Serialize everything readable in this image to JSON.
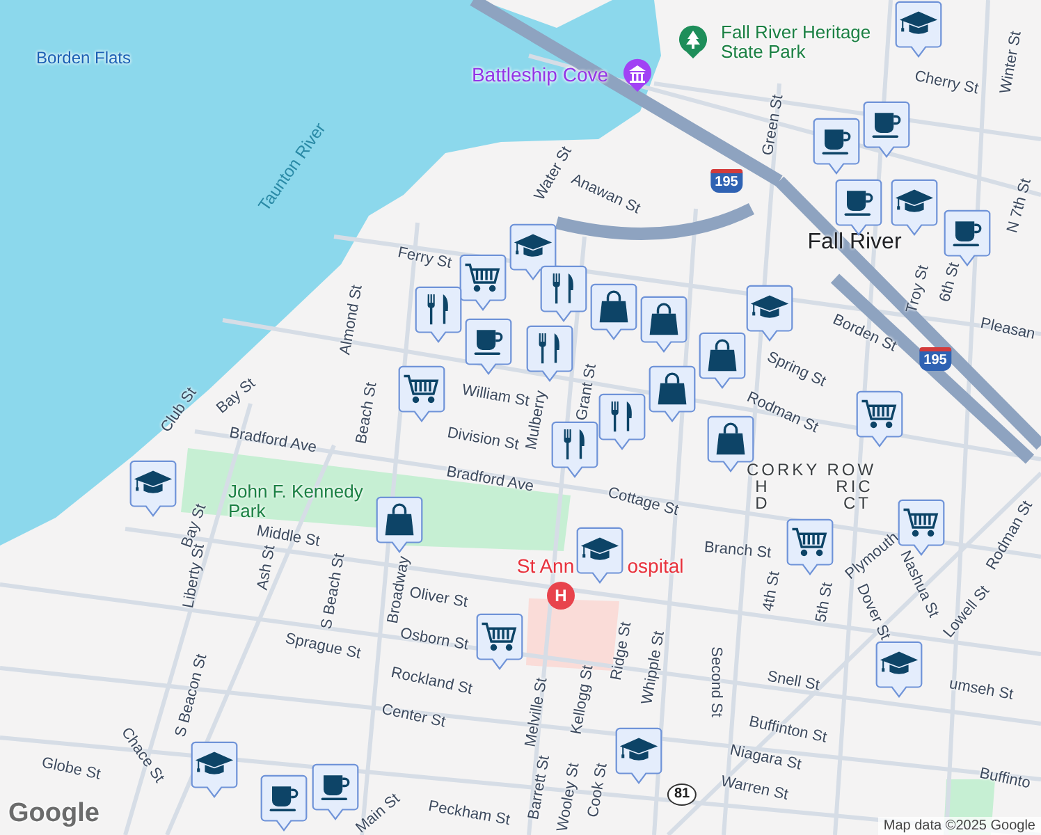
{
  "map": {
    "places": [
      {
        "text": "Borden Flats",
        "kind": "water"
      },
      {
        "text": "Taunton River",
        "kind": "river"
      },
      {
        "text": "Battleship Cove",
        "kind": "landmark"
      },
      {
        "text": "Fall River Heritage State Park",
        "kind": "park"
      },
      {
        "text": "John F. Kennedy Park",
        "kind": "park"
      },
      {
        "text": "Fall River",
        "kind": "city"
      },
      {
        "text": "CORKY ROW",
        "kind": "district"
      },
      {
        "text": "H",
        "kind": "district"
      },
      {
        "text": "RIC",
        "kind": "district"
      },
      {
        "text": "D",
        "kind": "district"
      },
      {
        "text": "CT",
        "kind": "district"
      },
      {
        "text": "St Ann",
        "kind": "hospital"
      },
      {
        "text": "ospital",
        "kind": "hospital"
      }
    ],
    "hospital_icon": "H",
    "streets": [
      "Ferry St",
      "Water St",
      "Anawan St",
      "Green St",
      "Cherry St",
      "Winter St",
      "N 7th St",
      "Troy St",
      "6th St",
      "Pleasan",
      "Borden St",
      "Spring St",
      "Rodman St",
      "Almond St",
      "Club St",
      "Bay St",
      "Beach St",
      "William St",
      "Division St",
      "Mulberry",
      "Grant St",
      "Bradford Ave",
      "Bradford Ave",
      "Bay St",
      "Middle St",
      "Cottage St",
      "Branch St",
      "Liberty St",
      "Ash St",
      "S Beach St",
      "Broadway",
      "Oliver St",
      "Osborn St",
      "Sprague St",
      "Rockland St",
      "Center St",
      "S Beacon St",
      "Chace St",
      "Globe St",
      "Main St",
      "Peckham St",
      "4th St",
      "5th St",
      "Plymouth",
      "Rodman St",
      "Nashua St",
      "Dover St",
      "Lowell St",
      "Ridge St",
      "Whipple St",
      "Second St",
      "Melville St",
      "Kellogg St",
      "Snell St",
      "umseh St",
      "Buffinton St",
      "Niagara St",
      "Warren St",
      "Buffinto",
      "Barrett St",
      "Wooley St",
      "Cook St"
    ],
    "highway_shields": [
      {
        "text": "195",
        "kind": "interstate"
      },
      {
        "text": "195",
        "kind": "interstate"
      },
      {
        "text": "81",
        "kind": "state"
      }
    ],
    "markers": [
      {
        "kind": "school"
      },
      {
        "kind": "coffee"
      },
      {
        "kind": "coffee"
      },
      {
        "kind": "coffee"
      },
      {
        "kind": "school"
      },
      {
        "kind": "coffee"
      },
      {
        "kind": "school"
      },
      {
        "kind": "cart"
      },
      {
        "kind": "food"
      },
      {
        "kind": "coffee"
      },
      {
        "kind": "food"
      },
      {
        "kind": "food"
      },
      {
        "kind": "bag"
      },
      {
        "kind": "bag"
      },
      {
        "kind": "school"
      },
      {
        "kind": "bag"
      },
      {
        "kind": "cart"
      },
      {
        "kind": "bag"
      },
      {
        "kind": "food"
      },
      {
        "kind": "food"
      },
      {
        "kind": "bag"
      },
      {
        "kind": "cart"
      },
      {
        "kind": "cart"
      },
      {
        "kind": "cart"
      },
      {
        "kind": "bag"
      },
      {
        "kind": "school"
      },
      {
        "kind": "school"
      },
      {
        "kind": "cart"
      },
      {
        "kind": "school"
      },
      {
        "kind": "school"
      },
      {
        "kind": "school"
      },
      {
        "kind": "coffee"
      },
      {
        "kind": "coffee"
      }
    ],
    "logo": "Google",
    "attribution": "Map data ©2025 Google"
  }
}
